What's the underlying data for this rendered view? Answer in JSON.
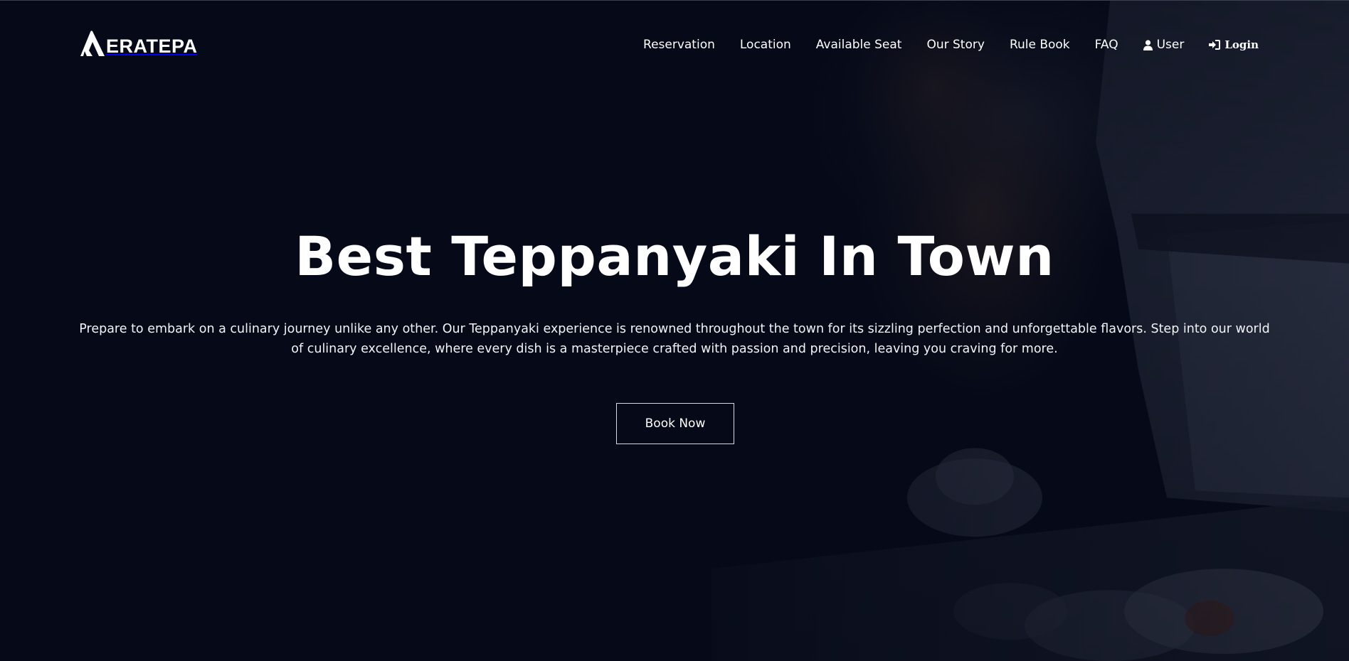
{
  "brand": {
    "name": "ERATEPA",
    "logo_icon": "m-peak-logo-icon"
  },
  "nav": {
    "items": [
      {
        "label": "Reservation"
      },
      {
        "label": "Location"
      },
      {
        "label": "Available Seat"
      },
      {
        "label": "Our Story"
      },
      {
        "label": "Rule Book"
      },
      {
        "label": "FAQ"
      }
    ],
    "user": {
      "label": "User",
      "icon": "user-icon"
    },
    "login": {
      "label": "Login",
      "icon": "sign-in-icon"
    }
  },
  "hero": {
    "title": "Best Teppanyaki In Town",
    "description": "Prepare to embark on a culinary journey unlike any other. Our Teppanyaki experience is renowned throughout the town for its sizzling perfection and unforgettable flavors. Step into our world of culinary excellence, where every dish is a masterpiece crafted with passion and precision, leaving you craving for more.",
    "cta_label": "Book Now",
    "background_image": "chef-flaming-teppanyaki-photo"
  },
  "colors": {
    "background": "#060a18",
    "text": "#ffffff",
    "button_border": "#d7d9e0"
  }
}
